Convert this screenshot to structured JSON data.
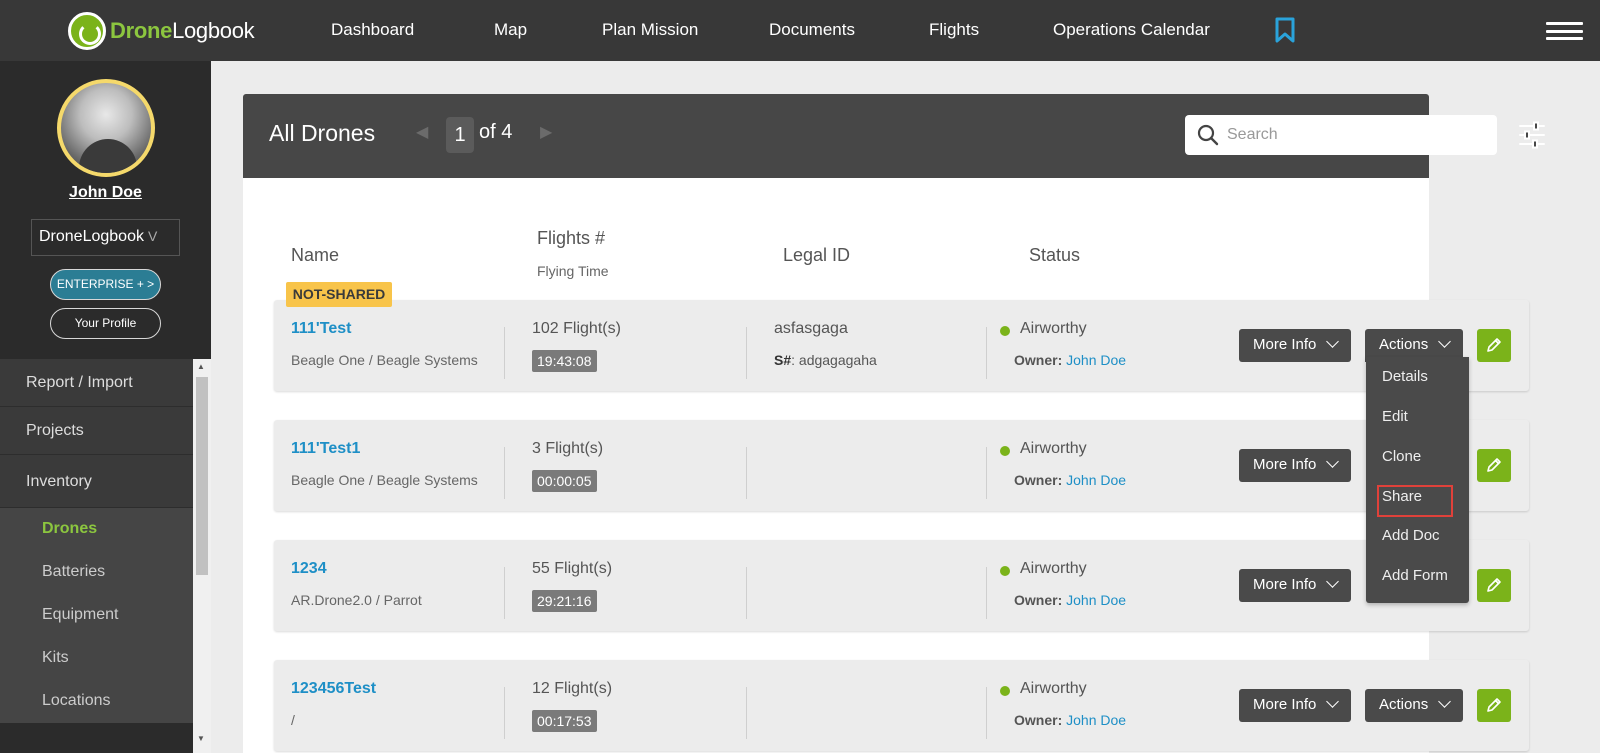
{
  "app": {
    "logo_prefix": "Drone",
    "logo_suffix": "Logbook"
  },
  "nav": {
    "items": [
      "Dashboard",
      "Map",
      "Plan Mission",
      "Documents",
      "Flights",
      "Operations Calendar"
    ]
  },
  "sidebar": {
    "user_name": "John Doe",
    "org": "DroneLogbook",
    "org_chevron": "V",
    "enterprise_label": "ENTERPRISE + >",
    "profile_label": "Your Profile",
    "menu": [
      "Report / Import",
      "Projects",
      "Inventory"
    ],
    "submenu": [
      "Drones",
      "Batteries",
      "Equipment",
      "Kits",
      "Locations"
    ]
  },
  "panel": {
    "title": "All Drones",
    "page_current": "1",
    "page_of": "of 4",
    "search_placeholder": "Search"
  },
  "columns": {
    "name": "Name",
    "flights": "Flights #",
    "flying_time": "Flying Time",
    "legal_id": "Legal ID",
    "status": "Status"
  },
  "rows": [
    {
      "tag": "NOT-SHARED",
      "name": "111'Test",
      "model": "Beagle One / Beagle Systems",
      "flights": "102 Flight(s)",
      "time": "19:43:08",
      "legal_id": "asfasgaga",
      "serial_label": "S#",
      "serial_value": ": adgagagaha",
      "status": "Airworthy",
      "owner_label": "Owner:",
      "owner": "John Doe",
      "more_info": "More Info",
      "actions": "Actions"
    },
    {
      "name": "111'Test1",
      "model": "Beagle One / Beagle Systems",
      "flights": "3 Flight(s)",
      "time": "00:00:05",
      "status": "Airworthy",
      "owner_label": "Owner:",
      "owner": "John Doe",
      "more_info": "More Info"
    },
    {
      "name": "1234",
      "model": "AR.Drone2.0 / Parrot",
      "flights": "55 Flight(s)",
      "time": "29:21:16",
      "status": "Airworthy",
      "owner_label": "Owner:",
      "owner": "John Doe",
      "more_info": "More Info"
    },
    {
      "name": "123456Test",
      "model": "/",
      "flights": "12 Flight(s)",
      "time": "00:17:53",
      "status": "Airworthy",
      "owner_label": "Owner:",
      "owner": "John Doe",
      "more_info": "More Info",
      "actions": "Actions"
    }
  ],
  "actions_menu": [
    "Details",
    "Edit",
    "Clone",
    "Share",
    "Add Doc",
    "Add Form"
  ],
  "colors": {
    "accent_green": "#7bb31a",
    "link_blue": "#1e8fc6",
    "tag_yellow": "#f8c44a",
    "highlight_red": "#e0413a"
  }
}
